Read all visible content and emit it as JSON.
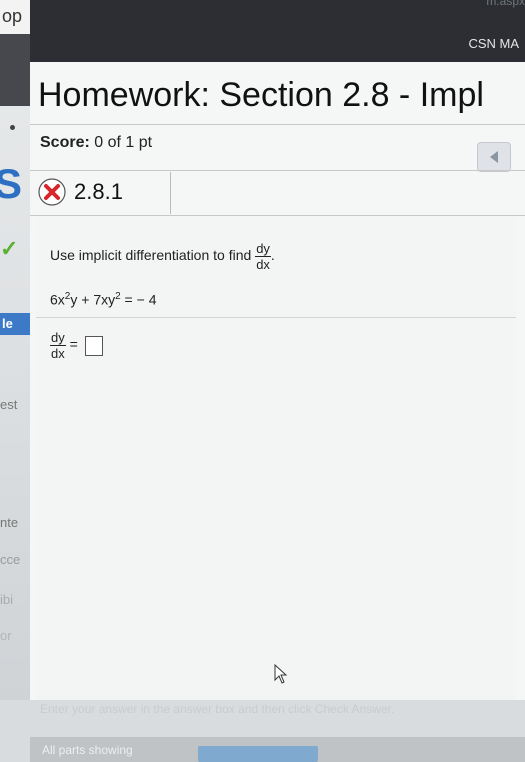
{
  "left_panel": {
    "top_label": "op",
    "labels": [
      "le",
      "est",
      "nte",
      "cce",
      "ibi",
      "or"
    ]
  },
  "header": {
    "url_fragment": "m.aspx",
    "course": "CSN MA"
  },
  "assignment": {
    "title": "Homework: Section 2.8 - Impl",
    "score_label": "Score:",
    "score_value": "0 of 1 pt"
  },
  "question": {
    "number": "2.8.1",
    "status_icon": "incorrect-x-icon",
    "prompt": "Use implicit differentiation to find",
    "deriv_num": "dy",
    "deriv_den": "dx",
    "equation": {
      "c1": "6x",
      "e1": "2",
      "t1": "y + 7xy",
      "e2": "2",
      "rhs": " = − 4"
    },
    "answer_prefix": "="
  },
  "footer": {
    "help_text": "Enter your answer in the answer box and then click Check Answer.",
    "parts_text": "All parts showing"
  },
  "colors": {
    "accent_blue": "#2d6fc2",
    "error_red": "#d9262b",
    "topbar": "#2c2e33"
  }
}
